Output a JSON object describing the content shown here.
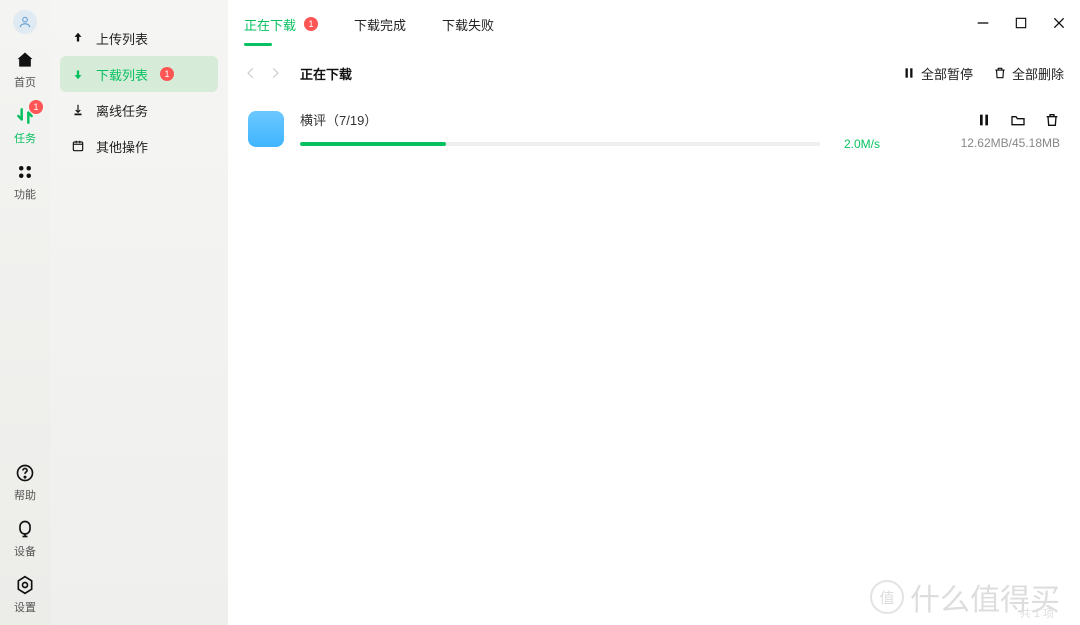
{
  "rail": {
    "home": "首页",
    "tasks": "任务",
    "tasks_badge": "1",
    "features": "功能",
    "help": "帮助",
    "device": "设备",
    "settings": "设置"
  },
  "sidebar": {
    "upload": "上传列表",
    "download": "下载列表",
    "download_badge": "1",
    "offline": "离线任务",
    "other": "其他操作"
  },
  "tabs": {
    "downloading": "正在下载",
    "downloading_badge": "1",
    "done": "下载完成",
    "failed": "下载失败"
  },
  "toolbar": {
    "title": "正在下载",
    "pause_all": "全部暂停",
    "delete_all": "全部删除"
  },
  "item": {
    "name": "横评（7/19）",
    "speed": "2.0M/s",
    "size": "12.62MB/45.18MB",
    "progress_pct": 28
  },
  "watermark": {
    "brand": "什么值得买",
    "logo": "值",
    "sub": "共 1 项"
  },
  "colors": {
    "accent": "#07c160",
    "badge": "#f55",
    "folder": "#40b5ff"
  }
}
